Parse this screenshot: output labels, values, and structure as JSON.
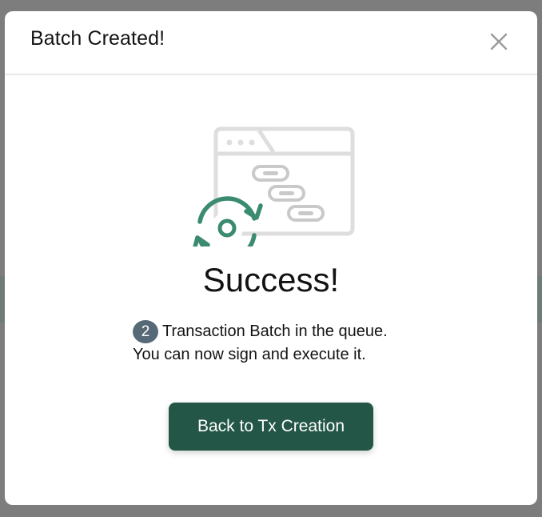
{
  "modal": {
    "title": "Batch Created!",
    "close_icon": "close-icon"
  },
  "content": {
    "heading": "Success!",
    "batch_count": "2",
    "message_line1": "Transaction Batch in the queue.",
    "message_line2": "You can now sign and execute it.",
    "button_label": "Back to Tx Creation",
    "illustration_icon": "batch-success-illustration"
  },
  "colors": {
    "accent_green": "#235646",
    "icon_green": "#3a8b70",
    "badge": "#566976",
    "illustration_gray": "#dedede"
  }
}
